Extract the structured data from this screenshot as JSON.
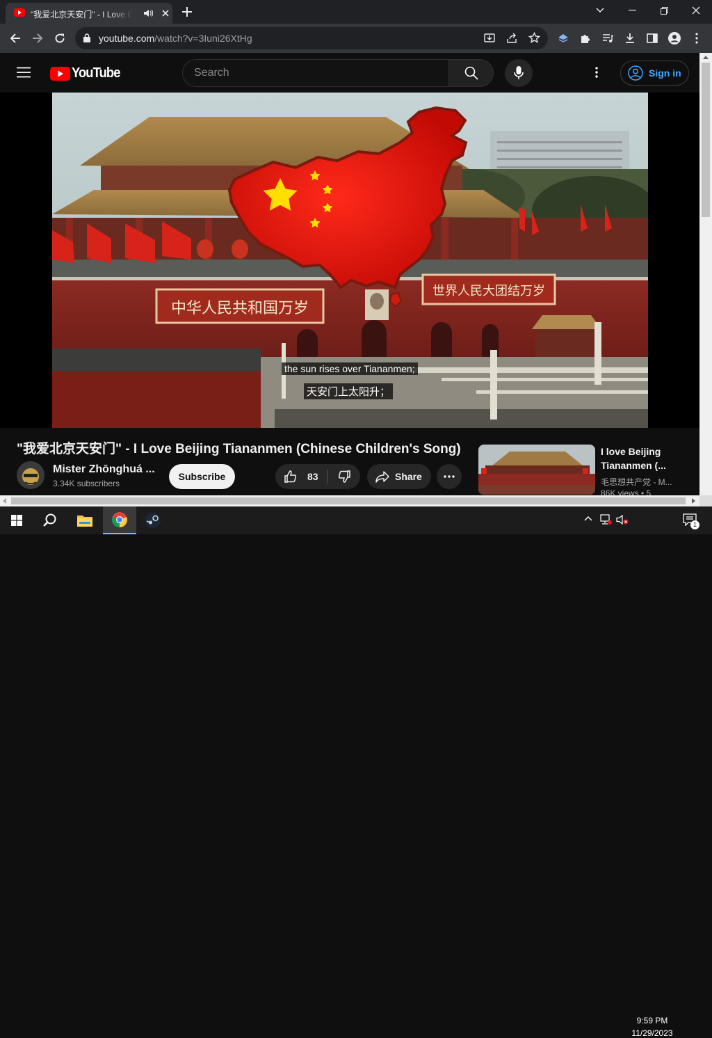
{
  "browser": {
    "tab_title": "\"我爱北京天安门\" - I Love Beijing Tiananmen (Chinese Children's Song) - YouTube",
    "url_host": "youtube.com",
    "url_path": "/watch?v=3Iuni26XtHg"
  },
  "masthead": {
    "logo_text": "YouTube",
    "search_placeholder": "Search",
    "signin_label": "Sign in"
  },
  "video": {
    "caption_en": "the sun rises over Tiananmen;",
    "caption_zh": "天安门上太阳升；",
    "banner_left": "中华人民共和国万岁",
    "banner_right": "世界人民大团结万岁"
  },
  "info": {
    "title": "\"我爱北京天安门\" - I Love Beijing Tiananmen (Chinese Children's Song)",
    "channel_name": "Mister Zhōnghuá ...",
    "subscribers": "3.34K subscribers",
    "subscribe_label": "Subscribe",
    "likes": "83",
    "share_label": "Share"
  },
  "related": [
    {
      "title": "I love Beijing Tiananmen (...",
      "channel": "毛思想共产党 - M...",
      "views": "86K views • 5"
    }
  ],
  "taskbar": {
    "time": "9:59 PM",
    "date": "11/29/2023",
    "notification_count": "1"
  },
  "colors": {
    "yt_red": "#ff0000",
    "link_blue": "#3ea6ff",
    "chrome_dark": "#202124"
  }
}
